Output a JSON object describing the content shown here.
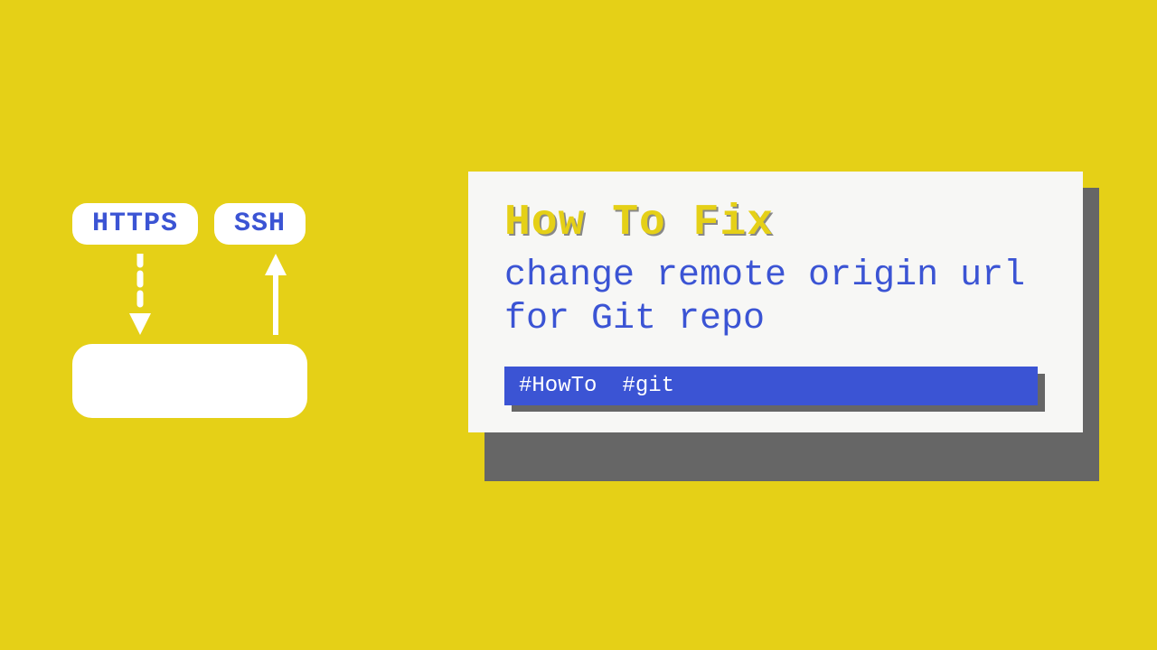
{
  "diagram": {
    "pill_https": "HTTPS",
    "pill_ssh": "SSH"
  },
  "card": {
    "heading": "How To Fix",
    "subheading": "change remote origin url for Git repo",
    "tag1": "#HowTo",
    "tag2": "#git"
  }
}
